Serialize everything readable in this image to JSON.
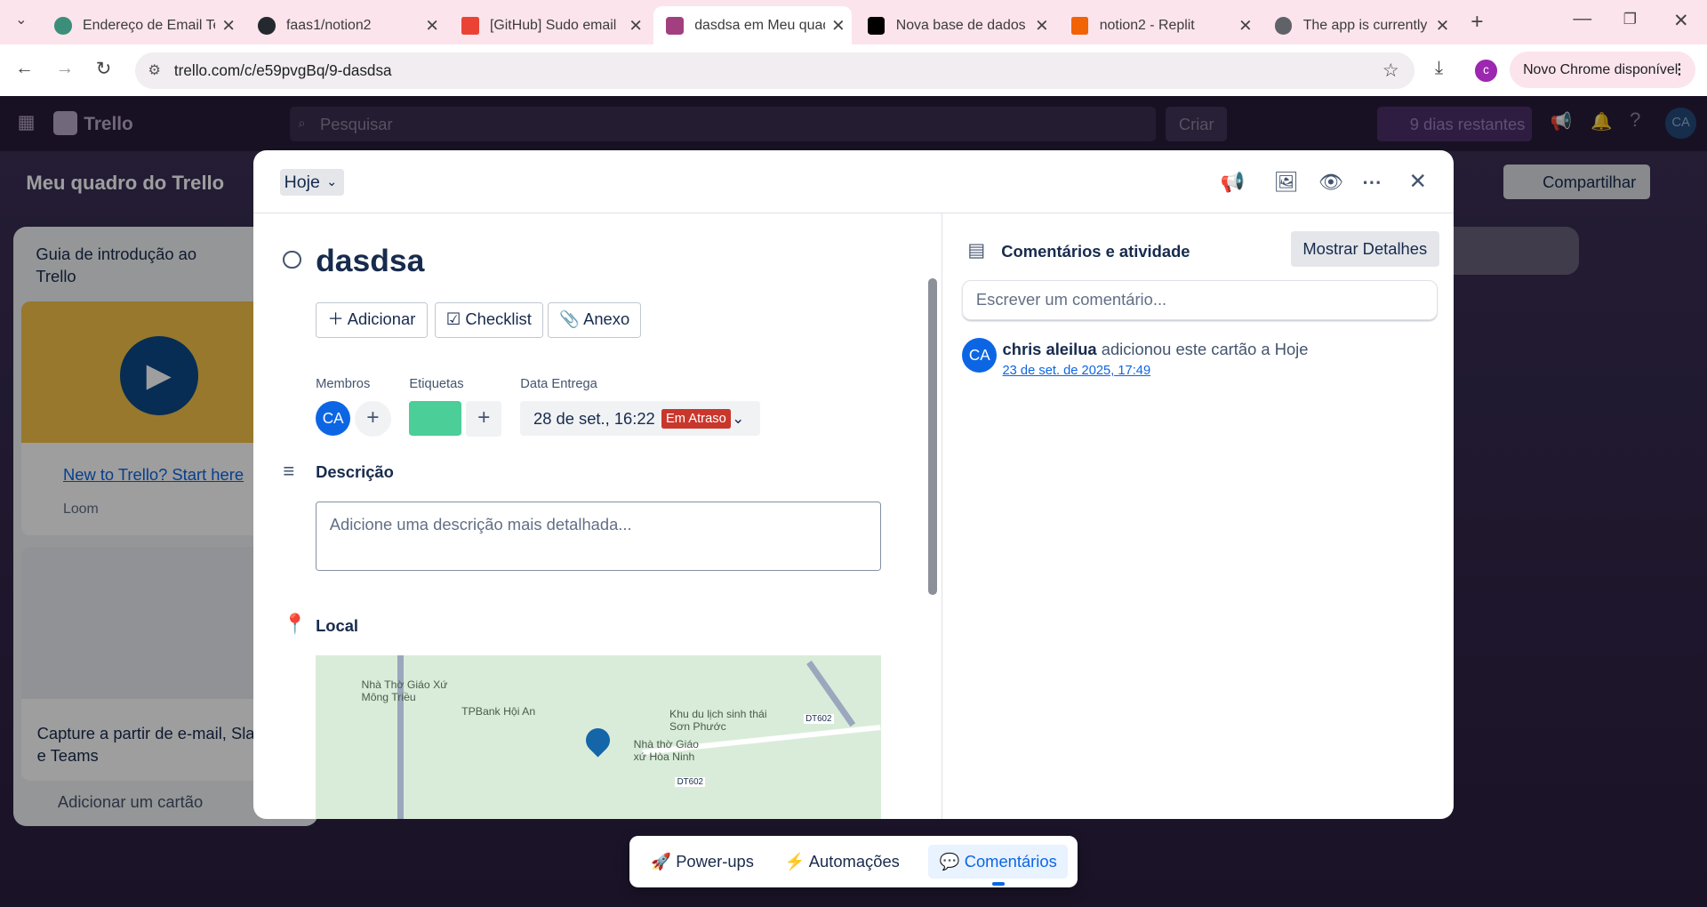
{
  "browser": {
    "tabs": [
      {
        "label": "Endereço de Email Te",
        "favicon": "email-favicon",
        "color": "#3b8f7a"
      },
      {
        "label": "faas1/notion2",
        "favicon": "github-icon",
        "color": "#24292f"
      },
      {
        "label": "[GitHub] Sudo email",
        "favicon": "gmail-icon",
        "color": "#ea4335"
      },
      {
        "label": "dasdsa em Meu quad",
        "favicon": "trello-icon",
        "color": "#a2407f"
      },
      {
        "label": "Nova base de dados",
        "favicon": "notion-icon",
        "color": "#000000"
      },
      {
        "label": "notion2 - Replit",
        "favicon": "replit-icon",
        "color": "#f26207"
      },
      {
        "label": "The app is currently",
        "favicon": "globe-icon",
        "color": "#5f6368"
      }
    ],
    "url": "trello.com/c/e59pvgBq/9-dasdsa",
    "profile_initial": "c",
    "update_label": "Novo Chrome disponível"
  },
  "trello": {
    "logo": "Trello",
    "search_placeholder": "Pesquisar",
    "create_label": "Criar",
    "trial_label": "9 dias restantes",
    "user_initials": "CA",
    "board_title": "Meu quadro do Trello",
    "share_label": "Compartilhar",
    "list_title": "Guia de introdução ao Trello",
    "card1_link": "New to Trello? Start here",
    "card1_source": "Loom",
    "card2_text": "Capture a partir de e-mail, Slack e Teams",
    "add_card": "Adicionar um cartão"
  },
  "card": {
    "list_chip": "Hoje",
    "title": "dasdsa",
    "actions": {
      "add": "Adicionar",
      "checklist": "Checklist",
      "attachment": "Anexo"
    },
    "members_label": "Membros",
    "member_initials": "CA",
    "labels_label": "Etiquetas",
    "label_color": "#4bce97",
    "due_label": "Data Entrega",
    "due_value": "28 de set., 16:22",
    "due_status": "Em Atraso",
    "description_heading": "Descrição",
    "description_placeholder": "Adicione uma descrição mais detalhada...",
    "location_heading": "Local",
    "map_labels": [
      "Nhà Thờ Giáo Xứ Mông Triều",
      "TPBank Hội An",
      "Khu du lịch sinh thái Sơn Phước",
      "Nhà thờ Giáo xứ Hòa Ninh",
      "DT602",
      "DT602"
    ]
  },
  "activity": {
    "heading": "Comentários e atividade",
    "toggle_label": "Mostrar Detalhes",
    "comment_placeholder": "Escrever um comentário...",
    "entries": [
      {
        "initials": "CA",
        "user": "chris aleilua",
        "text": " adicionou este cartão a Hoje",
        "time": "23 de set. de 2025, 17:49"
      }
    ]
  },
  "bottom_bar": {
    "powerups": "Power-ups",
    "automations": "Automações",
    "comments": "Comentários"
  }
}
